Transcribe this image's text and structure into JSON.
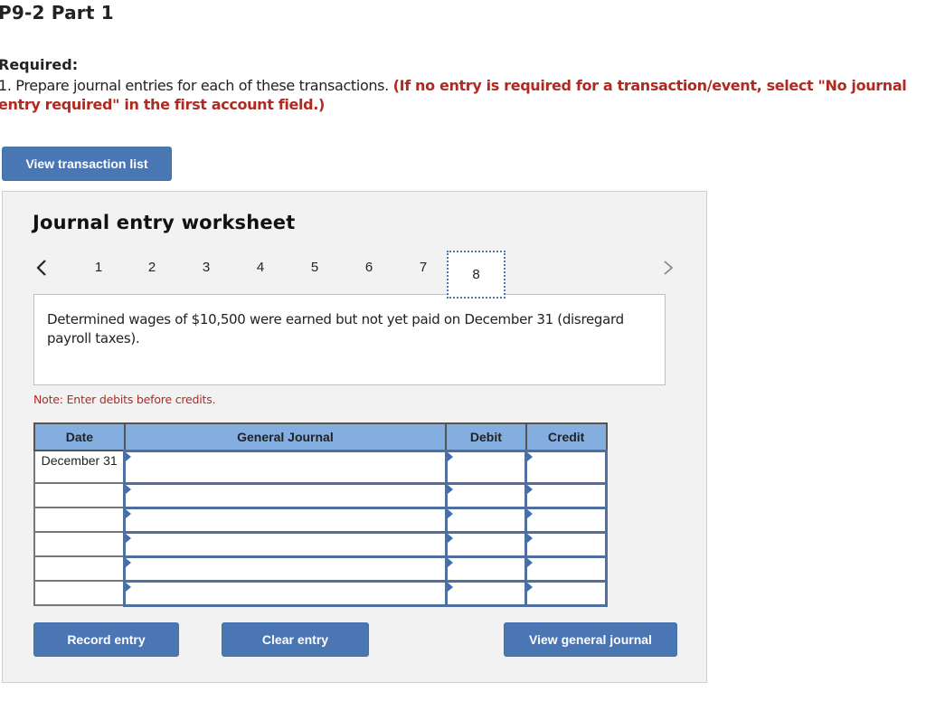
{
  "page": {
    "title": "P9-2 Part 1",
    "required_label": "Required:",
    "instruction_plain": "1. Prepare journal entries for each of these transactions. ",
    "instruction_emphasis": "(If no entry is required for a transaction/event, select \"No journal entry required\" in the first account field.)",
    "view_transaction_list_label": "View transaction list"
  },
  "worksheet": {
    "title": "Journal entry worksheet",
    "pagination": {
      "prev_icon": "chevron-left-icon",
      "next_icon": "chevron-right-icon",
      "pages": [
        "1",
        "2",
        "3",
        "4",
        "5",
        "6",
        "7",
        "8"
      ],
      "active_page": "8"
    },
    "description": "Determined wages of $10,500 were earned but not yet paid on December 31 (disregard payroll taxes).",
    "note": "Note: Enter debits before credits.",
    "table": {
      "headers": {
        "date": "Date",
        "general_journal": "General Journal",
        "debit": "Debit",
        "credit": "Credit"
      },
      "rows": [
        {
          "date": "December 31",
          "account": "",
          "debit": "",
          "credit": ""
        },
        {
          "date": "",
          "account": "",
          "debit": "",
          "credit": ""
        },
        {
          "date": "",
          "account": "",
          "debit": "",
          "credit": ""
        },
        {
          "date": "",
          "account": "",
          "debit": "",
          "credit": ""
        },
        {
          "date": "",
          "account": "",
          "debit": "",
          "credit": ""
        },
        {
          "date": "",
          "account": "",
          "debit": "",
          "credit": ""
        }
      ]
    },
    "buttons": {
      "record": "Record entry",
      "clear": "Clear entry",
      "view_general_journal": "View general journal"
    }
  },
  "colors": {
    "button_blue": "#4a76b4",
    "header_blue": "#84aee0",
    "emphasis_red": "#b02a22",
    "panel_bg": "#f2f2f2"
  }
}
